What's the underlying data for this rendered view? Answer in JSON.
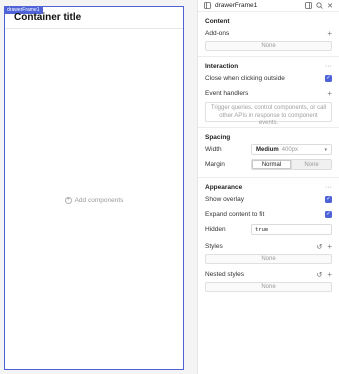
{
  "canvas": {
    "frame_tag": "drawerFrame1",
    "container_title": "Container title",
    "add_components": "Add components"
  },
  "panel": {
    "title": "drawerFrame1",
    "content": {
      "title": "Content",
      "addons_label": "Add-ons",
      "addons_value": "None"
    },
    "interaction": {
      "title": "Interaction",
      "close_outside_label": "Close when clicking outside",
      "close_outside_checked": true,
      "event_handlers_label": "Event handlers",
      "event_handlers_placeholder": "Trigger queries, control components, or call other APIs in response to component events."
    },
    "spacing": {
      "title": "Spacing",
      "width_label": "Width",
      "width_value": "Medium",
      "width_sub": "400px",
      "margin_label": "Margin",
      "margin_options": [
        "Normal",
        "None"
      ],
      "margin_selected": "Normal"
    },
    "appearance": {
      "title": "Appearance",
      "show_overlay_label": "Show overlay",
      "show_overlay_checked": true,
      "expand_label": "Expand content to fit",
      "expand_checked": true,
      "hidden_label": "Hidden",
      "hidden_value": "true",
      "styles_label": "Styles",
      "styles_value": "None",
      "nested_styles_label": "Nested styles",
      "nested_styles_value": "None"
    }
  },
  "colors": {
    "accent": "#4f63d9",
    "panel_bg": "#ffffff",
    "canvas_bg": "#f4f4f5"
  },
  "icons": {
    "panel_left": "sidebar-toggle-icon",
    "header_right": [
      "dock-icon",
      "search-icon",
      "close-icon"
    ]
  }
}
